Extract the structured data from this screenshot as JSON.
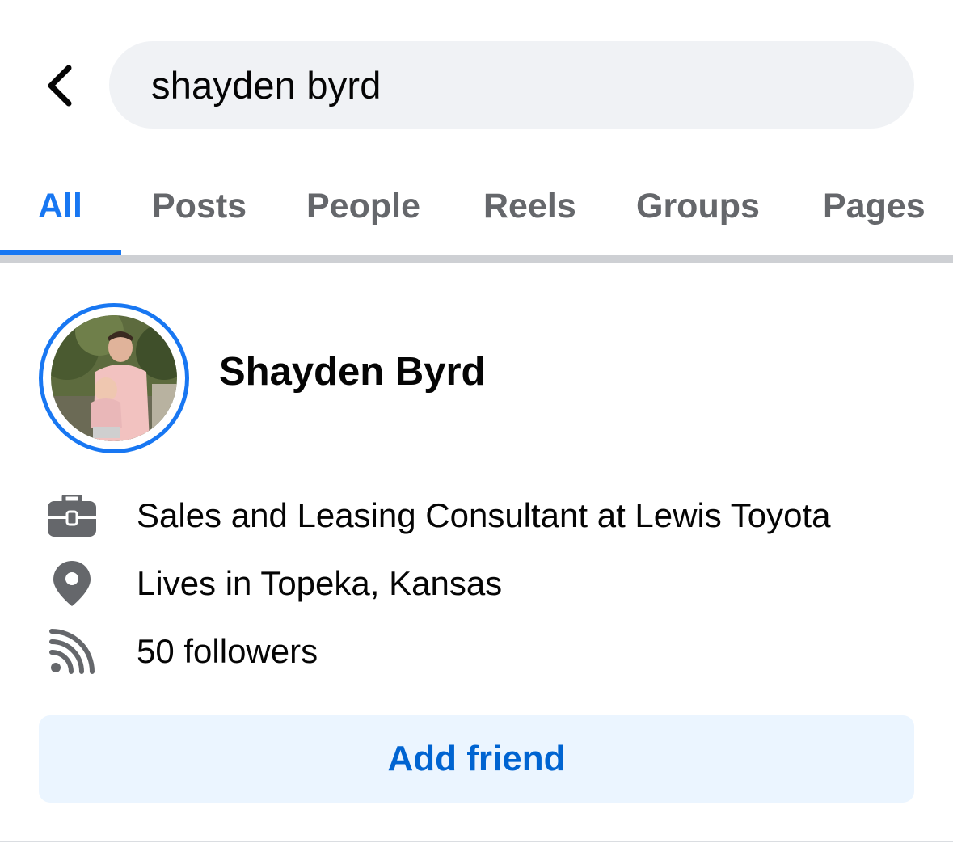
{
  "header": {
    "back_icon": "chevron-left-icon",
    "search_value": "shayden byrd"
  },
  "tabs": [
    {
      "label": "All",
      "active": true
    },
    {
      "label": "Posts",
      "active": false
    },
    {
      "label": "People",
      "active": false
    },
    {
      "label": "Reels",
      "active": false
    },
    {
      "label": "Groups",
      "active": false
    },
    {
      "label": "Pages",
      "active": false
    }
  ],
  "result": {
    "name": "Shayden Byrd",
    "avatar_icon": "profile-photo",
    "details": [
      {
        "icon": "briefcase-icon",
        "text": "Sales and Leasing Consultant at Lewis Toyota"
      },
      {
        "icon": "location-pin-icon",
        "text": "Lives in Topeka, Kansas"
      },
      {
        "icon": "rss-feed-icon",
        "text": "50 followers"
      }
    ],
    "add_friend_label": "Add friend"
  },
  "colors": {
    "accent": "#1877f2",
    "button_text": "#0064d1",
    "button_bg": "#ebf5ff",
    "search_bg": "#f0f2f5",
    "secondary_text": "#65676b",
    "icon_gray": "#65676b"
  }
}
